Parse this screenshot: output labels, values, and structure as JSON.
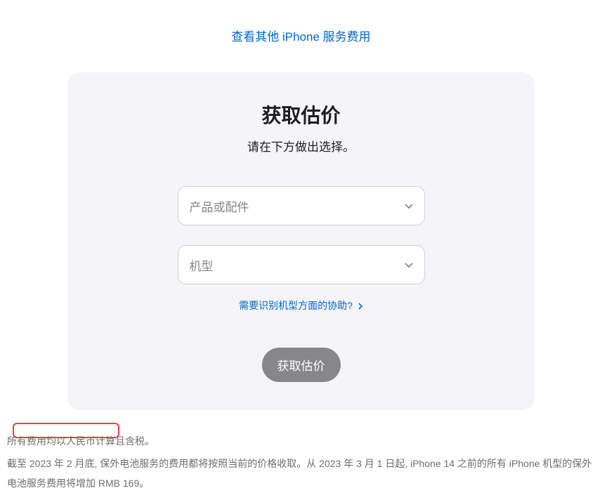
{
  "topLink": {
    "label": "查看其他 iPhone 服务费用"
  },
  "card": {
    "title": "获取估价",
    "subtitle": "请在下方做出选择。",
    "select1": {
      "placeholder": "产品或配件"
    },
    "select2": {
      "placeholder": "机型"
    },
    "helpLink": {
      "label": "需要识别机型方面的协助?"
    },
    "submit": {
      "label": "获取估价"
    }
  },
  "footer": {
    "line1": "所有费用均以人民币计算且含税。",
    "line2": "截至 2023 年 2 月底, 保外电池服务的费用都将按照当前的价格收取。从 2023 年 3 月 1 日起, iPhone 14 之前的所有 iPhone 机型的保外电池服务费用将增加 RMB 169。"
  }
}
